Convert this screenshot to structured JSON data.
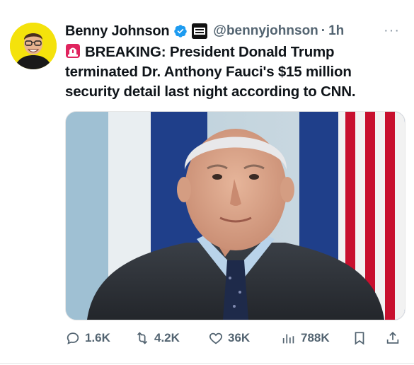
{
  "author": {
    "name": "Benny Johnson",
    "handle": "@bennyjohnson",
    "separator": "·",
    "time": "1h",
    "verified_icon": "verified-badge-icon",
    "affiliate_badge_text": "BENNY SHOW"
  },
  "tweet": {
    "text_line1": "BREAKING: President Donald Trump",
    "text_line2": "terminated Dr. Anthony Fauci's $15 million",
    "text_line3": "security detail last night according to CNN.",
    "emoji": "siren-icon"
  },
  "actions": {
    "replies": "1.6K",
    "reposts": "4.2K",
    "likes": "36K",
    "views": "788K"
  },
  "colors": {
    "verified": "#1d9bf0",
    "muted": "#536471",
    "avatar_bg": "#f4e20c",
    "siren_red": "#e0245e"
  },
  "more_label": "···"
}
